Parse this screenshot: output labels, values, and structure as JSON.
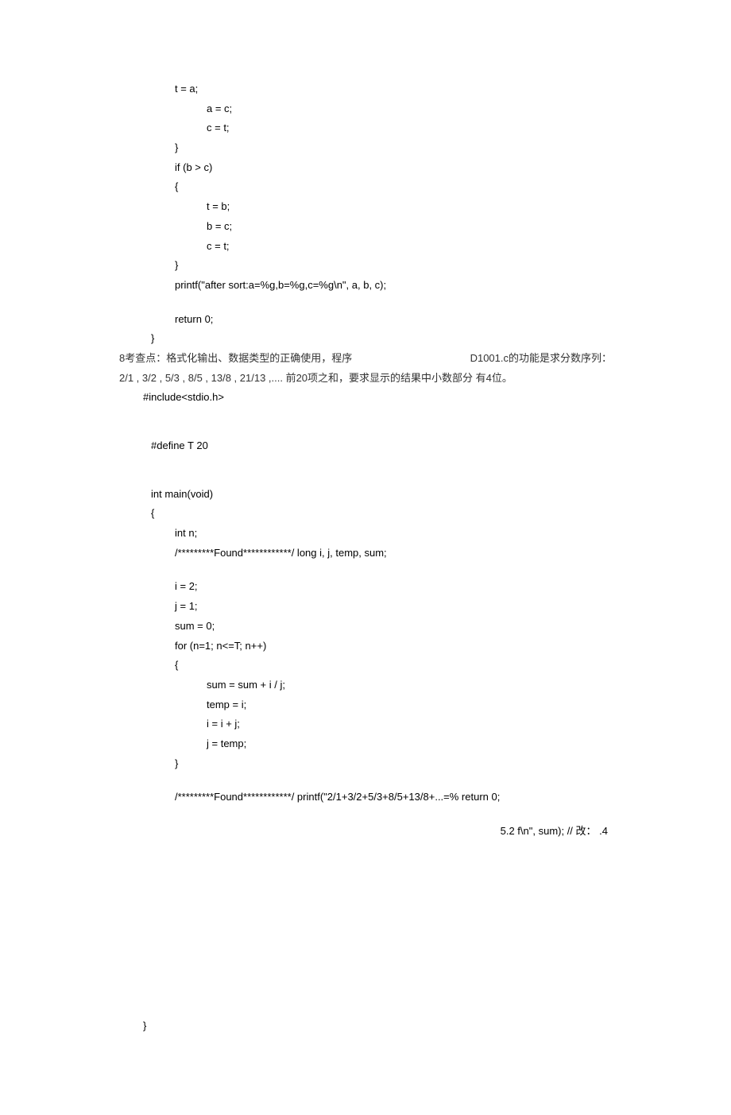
{
  "block1": {
    "l01": "t = a;",
    "l02": "a = c;",
    "l03": "c = t;",
    "l04": "}",
    "l05": "if (b > c)",
    "l06": "{",
    "l07": "t = b;",
    "l08": "b = c;",
    "l09": "c = t;",
    "l10": "}",
    "l11": "printf(\"after sort:a=%g,b=%g,c=%g\\n\", a, b, c);",
    "l12": "return 0;",
    "l13": "}"
  },
  "prose": {
    "p1_left": "8考查点：格式化输出、数据类型的正确使用，程序",
    "p1_right": "D1001.c的功能是求分数序列：",
    "p2": "2/1 , 3/2 , 5/3 , 8/5 , 13/8 , 21/13 ,.... 前20项之和，要求显示的结果中小数部分  有4位。"
  },
  "block2": {
    "l01": "#include<stdio.h>",
    "l02": "#define T 20",
    "l03": "int main(void)",
    "l04": "{",
    "l05": "int n;",
    "l06": "/*********Found************/ long i, j, temp, sum;",
    "l07": "i = 2;",
    "l08": "j = 1;",
    "l09": "sum = 0;",
    "l10": "for (n=1; n<=T; n++)",
    "l11": "{",
    "l12": "sum = sum + i / j;",
    "l13": "temp = i;",
    "l14": "i = i + j;",
    "l15": "j = temp;",
    "l16": "}",
    "l17": "/*********Found************/ printf(\"2/1+3/2+5/3+8/5+13/8+...=% return 0;",
    "l18": "5.2 f\\n\", sum); // 改： .4",
    "l19": "}"
  }
}
